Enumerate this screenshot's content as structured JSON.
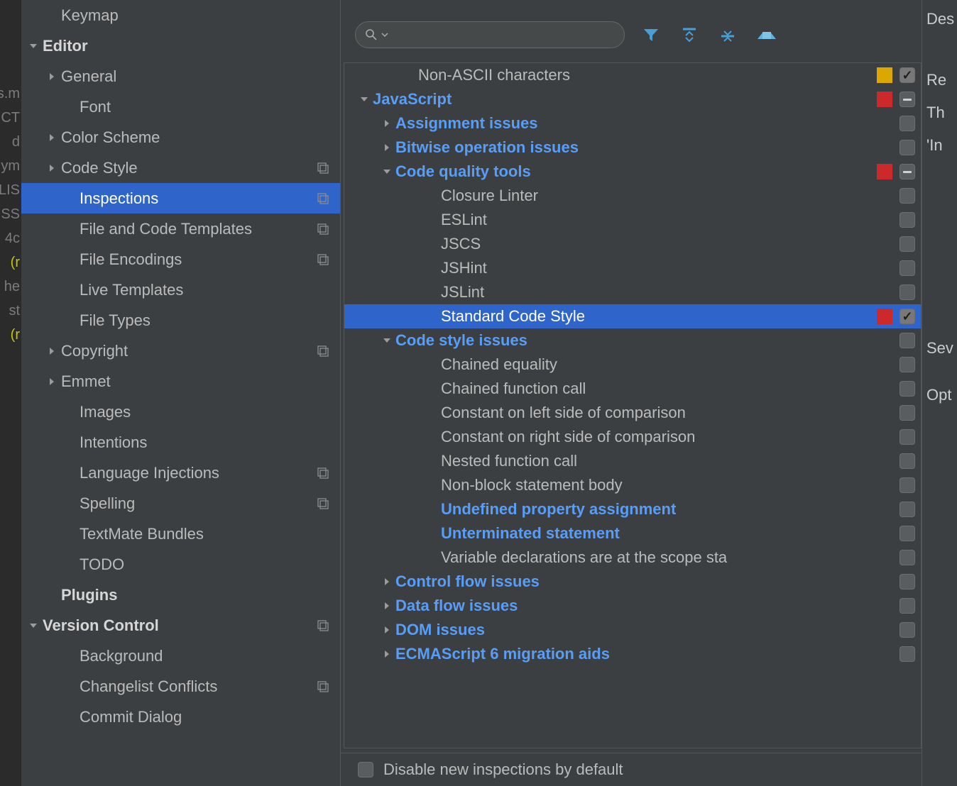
{
  "gutter_lines": [
    {
      "t": "s.m",
      "c": ""
    },
    {
      "t": "",
      "c": ""
    },
    {
      "t": "CT",
      "c": ""
    },
    {
      "t": "d",
      "c": ""
    },
    {
      "t": "ym",
      "c": ""
    },
    {
      "t": "",
      "c": ""
    },
    {
      "t": "",
      "c": ""
    },
    {
      "t": "",
      "c": ""
    },
    {
      "t": "",
      "c": ""
    },
    {
      "t": "",
      "c": ""
    },
    {
      "t": "",
      "c": ""
    },
    {
      "t": "LIS",
      "c": ""
    },
    {
      "t": "SS.",
      "c": ""
    },
    {
      "t": "",
      "c": ""
    },
    {
      "t": "",
      "c": ""
    },
    {
      "t": "",
      "c": ""
    },
    {
      "t": "4c",
      "c": ""
    },
    {
      "t": "r)",
      "c": "y"
    },
    {
      "t": "he",
      "c": ""
    },
    {
      "t": "st",
      "c": ""
    },
    {
      "t": "r)",
      "c": "y"
    }
  ],
  "sidebar": [
    {
      "indent": 56,
      "label": "Keymap",
      "arrow": "",
      "bold": false,
      "scheme": false,
      "sel": false
    },
    {
      "indent": 30,
      "label": "Editor",
      "arrow": "down",
      "bold": true,
      "scheme": false,
      "sel": false
    },
    {
      "indent": 56,
      "label": "General",
      "arrow": "right",
      "bold": false,
      "scheme": false,
      "sel": false
    },
    {
      "indent": 82,
      "label": "Font",
      "arrow": "",
      "bold": false,
      "scheme": false,
      "sel": false
    },
    {
      "indent": 56,
      "label": "Color Scheme",
      "arrow": "right",
      "bold": false,
      "scheme": false,
      "sel": false
    },
    {
      "indent": 56,
      "label": "Code Style",
      "arrow": "right",
      "bold": false,
      "scheme": true,
      "sel": false
    },
    {
      "indent": 82,
      "label": "Inspections",
      "arrow": "",
      "bold": false,
      "scheme": true,
      "sel": true
    },
    {
      "indent": 82,
      "label": "File and Code Templates",
      "arrow": "",
      "bold": false,
      "scheme": true,
      "sel": false
    },
    {
      "indent": 82,
      "label": "File Encodings",
      "arrow": "",
      "bold": false,
      "scheme": true,
      "sel": false
    },
    {
      "indent": 82,
      "label": "Live Templates",
      "arrow": "",
      "bold": false,
      "scheme": false,
      "sel": false
    },
    {
      "indent": 82,
      "label": "File Types",
      "arrow": "",
      "bold": false,
      "scheme": false,
      "sel": false
    },
    {
      "indent": 56,
      "label": "Copyright",
      "arrow": "right",
      "bold": false,
      "scheme": true,
      "sel": false
    },
    {
      "indent": 56,
      "label": "Emmet",
      "arrow": "right",
      "bold": false,
      "scheme": false,
      "sel": false
    },
    {
      "indent": 82,
      "label": "Images",
      "arrow": "",
      "bold": false,
      "scheme": false,
      "sel": false
    },
    {
      "indent": 82,
      "label": "Intentions",
      "arrow": "",
      "bold": false,
      "scheme": false,
      "sel": false
    },
    {
      "indent": 82,
      "label": "Language Injections",
      "arrow": "",
      "bold": false,
      "scheme": true,
      "sel": false
    },
    {
      "indent": 82,
      "label": "Spelling",
      "arrow": "",
      "bold": false,
      "scheme": true,
      "sel": false
    },
    {
      "indent": 82,
      "label": "TextMate Bundles",
      "arrow": "",
      "bold": false,
      "scheme": false,
      "sel": false
    },
    {
      "indent": 82,
      "label": "TODO",
      "arrow": "",
      "bold": false,
      "scheme": false,
      "sel": false
    },
    {
      "indent": 56,
      "label": "Plugins",
      "arrow": "",
      "bold": true,
      "scheme": false,
      "sel": false
    },
    {
      "indent": 30,
      "label": "Version Control",
      "arrow": "down",
      "bold": true,
      "scheme": true,
      "sel": false
    },
    {
      "indent": 82,
      "label": "Background",
      "arrow": "",
      "bold": false,
      "scheme": false,
      "sel": false
    },
    {
      "indent": 82,
      "label": "Changelist Conflicts",
      "arrow": "",
      "bold": false,
      "scheme": true,
      "sel": false
    },
    {
      "indent": 82,
      "label": "Commit Dialog",
      "arrow": "",
      "bold": false,
      "scheme": false,
      "sel": false
    }
  ],
  "search": {
    "placeholder": ""
  },
  "tree": [
    {
      "indent": 80,
      "label": "Non-ASCII characters",
      "arrow": "",
      "link": false,
      "sev": "#dca800",
      "chk": "on",
      "sel": false
    },
    {
      "indent": 16,
      "label": "JavaScript",
      "arrow": "down",
      "link": true,
      "sev": "#cc2a2a",
      "chk": "mixed",
      "sel": false
    },
    {
      "indent": 48,
      "label": "Assignment issues",
      "arrow": "right",
      "link": true,
      "sev": "",
      "chk": "off",
      "sel": false
    },
    {
      "indent": 48,
      "label": "Bitwise operation issues",
      "arrow": "right",
      "link": true,
      "sev": "",
      "chk": "off",
      "sel": false
    },
    {
      "indent": 48,
      "label": "Code quality tools",
      "arrow": "down",
      "link": true,
      "sev": "#cc2a2a",
      "chk": "mixed",
      "sel": false
    },
    {
      "indent": 112,
      "label": "Closure Linter",
      "arrow": "",
      "link": false,
      "sev": "",
      "chk": "off",
      "sel": false
    },
    {
      "indent": 112,
      "label": "ESLint",
      "arrow": "",
      "link": false,
      "sev": "",
      "chk": "off",
      "sel": false
    },
    {
      "indent": 112,
      "label": "JSCS",
      "arrow": "",
      "link": false,
      "sev": "",
      "chk": "off",
      "sel": false
    },
    {
      "indent": 112,
      "label": "JSHint",
      "arrow": "",
      "link": false,
      "sev": "",
      "chk": "off",
      "sel": false
    },
    {
      "indent": 112,
      "label": "JSLint",
      "arrow": "",
      "link": false,
      "sev": "",
      "chk": "off",
      "sel": false
    },
    {
      "indent": 112,
      "label": "Standard Code Style",
      "arrow": "",
      "link": false,
      "sev": "#cc2a2a",
      "chk": "on",
      "sel": true
    },
    {
      "indent": 48,
      "label": "Code style issues",
      "arrow": "down",
      "link": true,
      "sev": "",
      "chk": "off",
      "sel": false
    },
    {
      "indent": 112,
      "label": "Chained equality",
      "arrow": "",
      "link": false,
      "sev": "",
      "chk": "off",
      "sel": false
    },
    {
      "indent": 112,
      "label": "Chained function call",
      "arrow": "",
      "link": false,
      "sev": "",
      "chk": "off",
      "sel": false
    },
    {
      "indent": 112,
      "label": "Constant on left side of comparison",
      "arrow": "",
      "link": false,
      "sev": "",
      "chk": "off",
      "sel": false
    },
    {
      "indent": 112,
      "label": "Constant on right side of comparison",
      "arrow": "",
      "link": false,
      "sev": "",
      "chk": "off",
      "sel": false
    },
    {
      "indent": 112,
      "label": "Nested function call",
      "arrow": "",
      "link": false,
      "sev": "",
      "chk": "off",
      "sel": false
    },
    {
      "indent": 112,
      "label": "Non-block statement body",
      "arrow": "",
      "link": false,
      "sev": "",
      "chk": "off",
      "sel": false
    },
    {
      "indent": 112,
      "label": "Undefined property assignment",
      "arrow": "",
      "link": true,
      "sev": "",
      "chk": "off",
      "sel": false
    },
    {
      "indent": 112,
      "label": "Unterminated statement",
      "arrow": "",
      "link": true,
      "sev": "",
      "chk": "off",
      "sel": false
    },
    {
      "indent": 112,
      "label": "Variable declarations are at the scope sta",
      "arrow": "",
      "link": false,
      "sev": "",
      "chk": "off",
      "sel": false
    },
    {
      "indent": 48,
      "label": "Control flow issues",
      "arrow": "right",
      "link": true,
      "sev": "",
      "chk": "off",
      "sel": false
    },
    {
      "indent": 48,
      "label": "Data flow issues",
      "arrow": "right",
      "link": true,
      "sev": "",
      "chk": "off",
      "sel": false
    },
    {
      "indent": 48,
      "label": "DOM issues",
      "arrow": "right",
      "link": true,
      "sev": "",
      "chk": "off",
      "sel": false
    },
    {
      "indent": 48,
      "label": "ECMAScript 6 migration aids",
      "arrow": "right",
      "link": true,
      "sev": "",
      "chk": "off",
      "sel": false
    }
  ],
  "footer": {
    "disable_label": "Disable new inspections by default"
  },
  "right": {
    "a": "Des",
    "b": "Re",
    "c": "Th",
    "d": "'In",
    "e": "Sev",
    "f": "Opt"
  }
}
